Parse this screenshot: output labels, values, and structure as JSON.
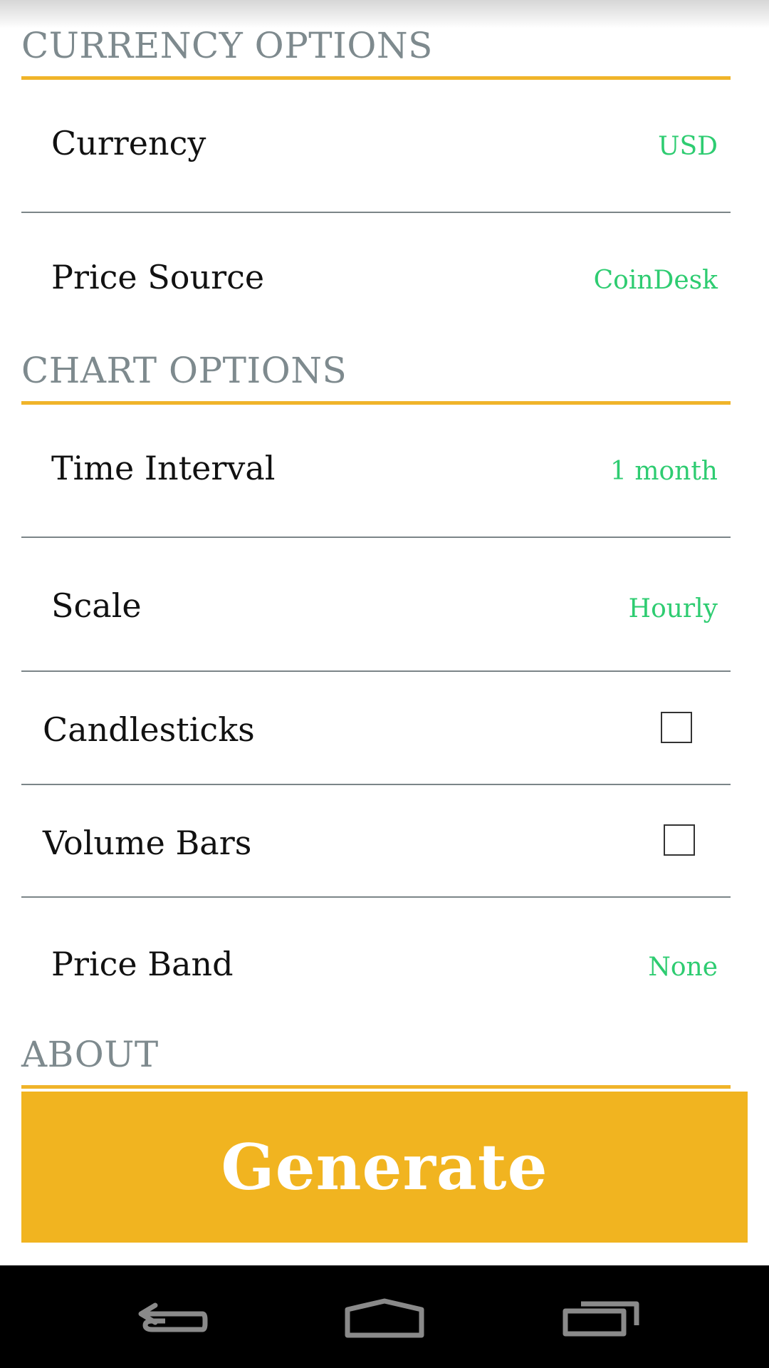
{
  "sections": {
    "currency": {
      "title": "CURRENCY OPTIONS"
    },
    "chart": {
      "title": "CHART OPTIONS"
    },
    "about": {
      "title": "ABOUT"
    }
  },
  "currency_options": {
    "currency": {
      "label": "Currency",
      "value": "USD"
    },
    "price_source": {
      "label": "Price Source",
      "value": "CoinDesk"
    }
  },
  "chart_options": {
    "time_interval": {
      "label": "Time Interval",
      "value": "1 month"
    },
    "scale": {
      "label": "Scale",
      "value": "Hourly"
    },
    "candlesticks": {
      "label": "Candlesticks",
      "checked": false
    },
    "volume_bars": {
      "label": "Volume Bars",
      "checked": false
    },
    "price_band": {
      "label": "Price Band",
      "value": "None"
    }
  },
  "generate_button": {
    "label": "Generate"
  },
  "nav_bar": {
    "icons": [
      "back-icon",
      "home-icon",
      "recent-apps-icon"
    ]
  },
  "colors": {
    "accent": "#f0b429",
    "value_text": "#2ecc71",
    "section_header_text": "#7e8a8e",
    "button_bg": "#f1b420"
  }
}
